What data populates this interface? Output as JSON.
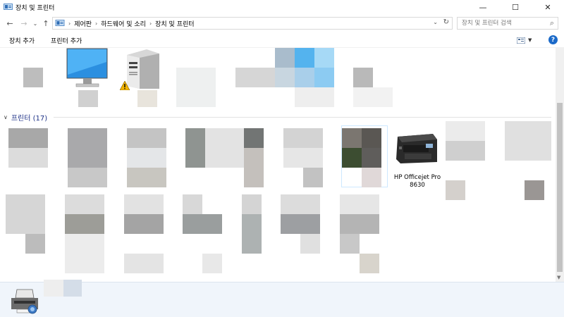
{
  "window": {
    "title": "장치 및 프린터",
    "controls": {
      "minimize": "—",
      "maximize": "☐",
      "close": "✕"
    }
  },
  "nav": {
    "back": "←",
    "forward": "→",
    "recent": "⌄",
    "up": "↑",
    "breadcrumbs": [
      "제어판",
      "하드웨어 및 소리",
      "장치 및 프린터"
    ],
    "search_placeholder": "장치 및 프린터 검색"
  },
  "commands": {
    "add_device": "장치 추가",
    "add_printer": "프린터 추가"
  },
  "help_label": "?",
  "printers_group": {
    "title": "프린터 (17)"
  },
  "visible_printer": {
    "name_line1": "HP Officejet Pro",
    "name_line2": "8630"
  },
  "colors": {
    "group_title": "#1e3287",
    "help_badge": "#1b6ac9",
    "details_pane": "#f0f5fb",
    "selection_border": "#cde8ff"
  },
  "icons": [
    "control-panel-icon",
    "monitor-icon",
    "computer-tower-icon",
    "warning-icon",
    "printer-icon",
    "details-printer-icon",
    "search-icon",
    "refresh-icon",
    "view-options-icon",
    "help-icon"
  ]
}
